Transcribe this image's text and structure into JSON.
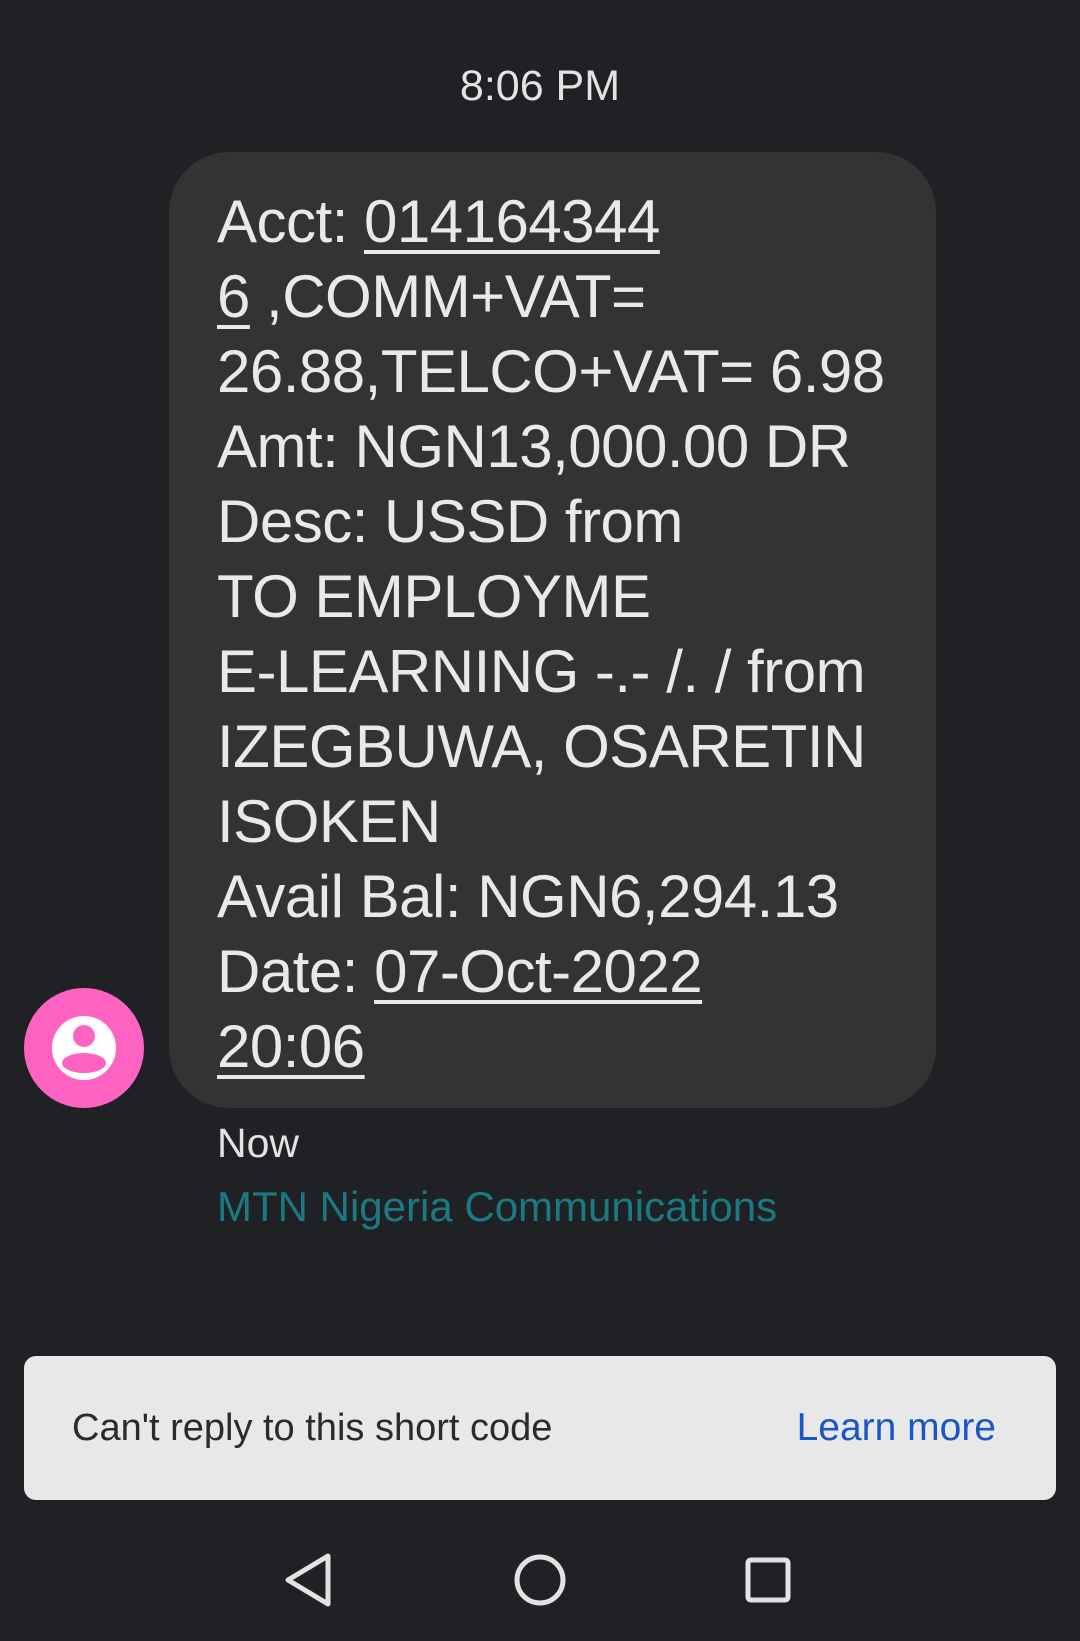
{
  "header": {
    "time": "8:06 PM"
  },
  "message": {
    "lines": {
      "l1_prefix": "Acct: ",
      "l1_link": "014164344",
      "l2_link": "6",
      "l2_rest": " ,COMM+VAT=",
      "l3": "26.88,TELCO+VAT= 6.98",
      "l4": "Amt: NGN13,000.00 DR",
      "l5": "Desc: USSD from",
      "l6": "TO EMPLOYME",
      "l7": "E-LEARNING -.- /. / from",
      "l8": "IZEGBUWA, OSARETIN",
      "l9": "ISOKEN",
      "l10": "Avail Bal: NGN6,294.13",
      "l11_prefix": "Date: ",
      "l11_link": "07-Oct-2022",
      "l12_link": "20:06"
    },
    "time_label": "Now",
    "sender": "MTN Nigeria Communications"
  },
  "notice": {
    "text": "Can't reply to this short code",
    "link": "Learn more"
  },
  "colors": {
    "background": "#202124",
    "bubble": "#333333",
    "avatar": "#ff63c1",
    "sender": "#1a7a84",
    "link": "#1a56c8"
  },
  "icons": {
    "avatar": "person-icon",
    "back": "triangle-back-icon",
    "home": "circle-home-icon",
    "recents": "square-recents-icon"
  }
}
